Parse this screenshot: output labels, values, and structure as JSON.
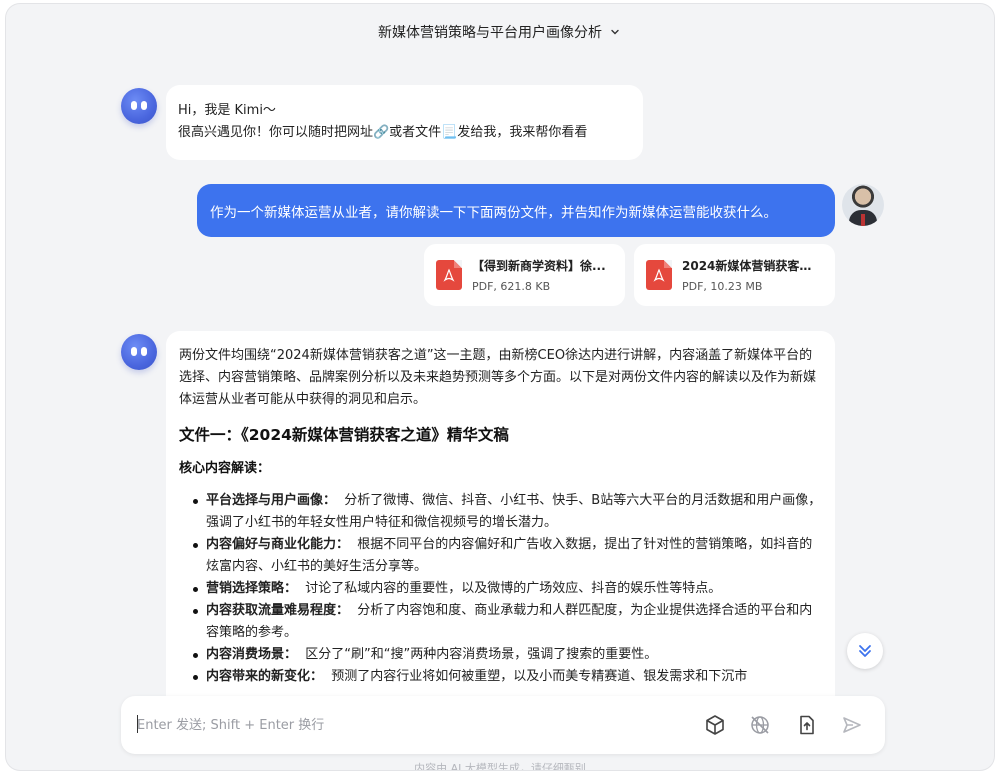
{
  "header": {
    "title": "新媒体营销策略与平台用户画像分析"
  },
  "greeting": {
    "line1": "Hi，我是 Kimi～",
    "line2": "很高兴遇见你！你可以随时把网址🔗或者文件📃发给我，我来帮你看看"
  },
  "user_message": {
    "text": "作为一个新媒体运营从业者，请你解读一下下面两份文件，并告知作为新媒体运营能收获什么。"
  },
  "files": [
    {
      "name": "【得到新商学资料】徐...",
      "size": "PDF, 621.8 KB",
      "icon": "pdf-icon"
    },
    {
      "name": "2024新媒体营销获客之道",
      "size": "PDF, 10.23 MB",
      "icon": "pdf-icon"
    }
  ],
  "answer": {
    "intro": "两份文件均围绕“2024新媒体营销获客之道”这一主题，由新榜CEO徐达内进行讲解，内容涵盖了新媒体平台的选择、内容营销策略、品牌案例分析以及未来趋势预测等多个方面。以下是对两份文件内容的解读以及作为新媒体运营从业者可能从中获得的洞见和启示。",
    "heading": "文件一：《2024新媒体营销获客之道》精华文稿",
    "subheading": "核心内容解读：",
    "items": [
      {
        "title": "平台选择与用户画像：",
        "text": "分析了微博、微信、抖音、小红书、快手、B站等六大平台的月活数据和用户画像，强调了小红书的年轻女性用户特征和微信视频号的增长潜力。"
      },
      {
        "title": "内容偏好与商业化能力：",
        "text": "根据不同平台的内容偏好和广告收入数据，提出了针对性的营销策略，如抖音的炫富内容、小红书的美好生活分享等。"
      },
      {
        "title": "营销选择策略：",
        "text": "讨论了私域内容的重要性，以及微博的广场效应、抖音的娱乐性等特点。"
      },
      {
        "title": "内容获取流量难易程度：",
        "text": "分析了内容饱和度、商业承载力和人群匹配度，为企业提供选择合适的平台和内容策略的参考。"
      },
      {
        "title": "内容消费场景：",
        "text": "区分了“刷”和“搜”两种内容消费场景，强调了搜索的重要性。"
      },
      {
        "title": "内容带来的新变化：",
        "text": "预测了内容行业将如何被重塑，以及小而美专精赛道、银发需求和下沉市"
      }
    ]
  },
  "input": {
    "placeholder": "Enter 发送; Shift + Enter 换行"
  },
  "toolbar": {
    "icons": [
      "cube-icon",
      "globe-off-icon",
      "upload-file-icon",
      "send-icon"
    ]
  },
  "footer": {
    "note": "内容由 AI 大模型生成，请仔细甄别"
  },
  "colors": {
    "accent": "#3d73ee",
    "pdf": "#e5483d",
    "background": "#f3f4f6"
  }
}
